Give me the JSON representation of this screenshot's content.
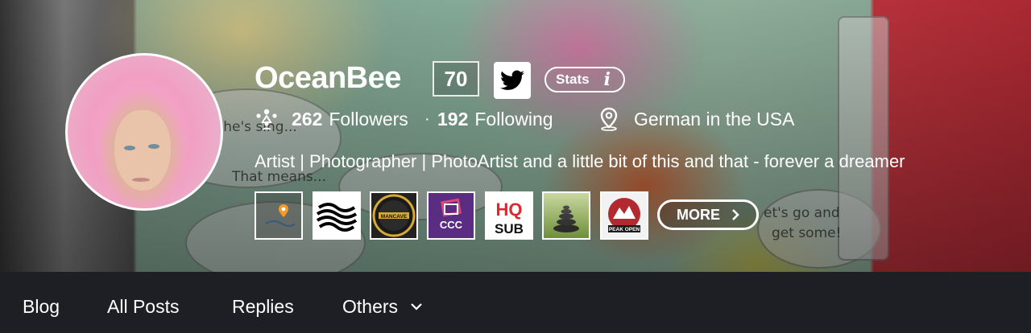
{
  "profile": {
    "name": "OceanBee",
    "reputation": "70",
    "stats_label": "Stats",
    "stats_info": "i",
    "followers_count": "262",
    "followers_label": "Followers",
    "following_count": "192",
    "following_label": "Following",
    "location": "German in the USA",
    "about": "Artist | Photographer | PhotoArtist and a little bit of this and that - forever a dreamer"
  },
  "badges": [
    {
      "icon": "map-pin-badge"
    },
    {
      "icon": "wave-globe-badge"
    },
    {
      "icon": "mancave-badge",
      "text": "MANCAVE"
    },
    {
      "icon": "ccc-badge",
      "text": "CCC"
    },
    {
      "icon": "hq-sub-badge",
      "text_top": "HQ",
      "text_bottom": "SUB"
    },
    {
      "icon": "stacked-stones-badge"
    },
    {
      "icon": "peak-open-badge",
      "text": "PEAK OPEN"
    }
  ],
  "more_label": "MORE",
  "tabs": [
    {
      "label": "Blog"
    },
    {
      "label": "All Posts"
    },
    {
      "label": "Replies"
    },
    {
      "label": "Others"
    }
  ],
  "colors": {
    "tab_bar": "#1e1f24",
    "text": "#ffffff",
    "ccc_purple": "#5a2d82",
    "hq_red": "#e3262e"
  }
}
